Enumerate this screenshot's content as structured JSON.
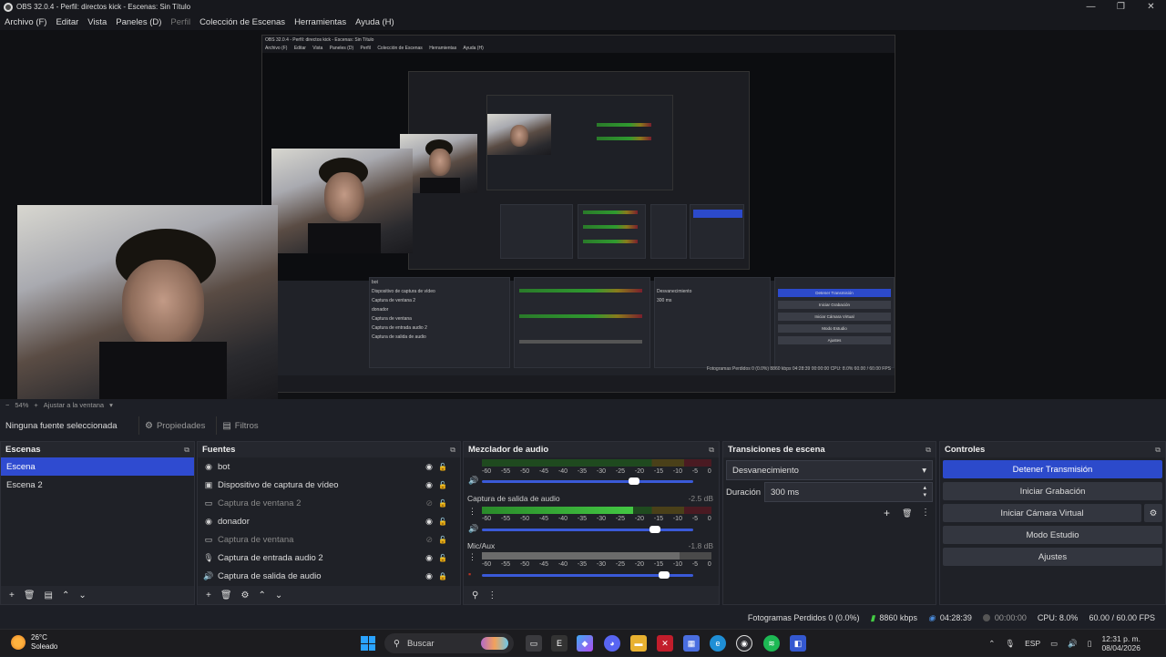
{
  "window": {
    "title": "OBS 32.0.4 - Perfil: directos kick - Escenas: Sin Título",
    "controls": [
      "—",
      "❐",
      "✕"
    ]
  },
  "menu": {
    "items": [
      "Archivo (F)",
      "Editar",
      "Vista",
      "Paneles (D)",
      "Perfil",
      "Colección de Escenas",
      "Herramientas",
      "Ayuda (H)"
    ]
  },
  "nested": {
    "title": "OBS 32.0.4 - Perfil: directos kick - Escenas: Sin Título",
    "menu": [
      "Archivo (F)",
      "Editar",
      "Vista",
      "Paneles (D)",
      "Perfil",
      "Colección de Escenas",
      "Herramientas",
      "Ayuda (H)"
    ],
    "status": "Fotogramas Perdidos 0 (0.0%)   8860 kbps   04:28:39   00:00:00   CPU: 8.0%   60.00 / 60.00 FPS",
    "controls": [
      "Detener Transmisión",
      "Iniciar Grabación",
      "Iniciar Cámara Virtual",
      "Modo Estudio",
      "Ajustes"
    ],
    "sources": [
      "bot",
      "Dispositivo de captura de vídeo",
      "Captura de ventana 2",
      "donador",
      "Captura de ventana",
      "Captura de entrada audio 2",
      "Captura de salida de audio"
    ],
    "transition": "Desvanecimiento",
    "duration": "300 ms"
  },
  "zoom": {
    "level": "54%",
    "fit": "Ajustar a la ventana"
  },
  "toolbar": {
    "no_source": "Ninguna fuente seleccionada",
    "properties": "Propiedades",
    "filters": "Filtros"
  },
  "scenes": {
    "title": "Escenas",
    "items": [
      "Escena",
      "Escena 2"
    ],
    "selected": "Escena"
  },
  "sources": {
    "title": "Fuentes",
    "items": [
      {
        "label": "bot",
        "icon": "globe-icon",
        "visible": true,
        "locked": false
      },
      {
        "label": "Dispositivo de captura de vídeo",
        "icon": "camera-icon",
        "visible": true,
        "locked": false
      },
      {
        "label": "Captura de ventana 2",
        "icon": "window-icon",
        "visible": false,
        "locked": false
      },
      {
        "label": "donador",
        "icon": "globe-icon",
        "visible": true,
        "locked": false
      },
      {
        "label": "Captura de ventana",
        "icon": "window-icon",
        "visible": false,
        "locked": false
      },
      {
        "label": "Captura de entrada audio 2",
        "icon": "mic-icon",
        "visible": true,
        "locked": false
      },
      {
        "label": "Captura de salida de audio",
        "icon": "speaker-icon",
        "visible": true,
        "locked": true
      }
    ]
  },
  "mixer": {
    "title": "Mezclador de audio",
    "scale": [
      "-60",
      "-55",
      "-50",
      "-45",
      "-40",
      "-35",
      "-30",
      "-25",
      "-20",
      "-15",
      "-10",
      "-5",
      "0"
    ],
    "channels": [
      {
        "name": "",
        "db": "",
        "level": 0.0,
        "volume": 0.72
      },
      {
        "name": "Captura de salida de audio",
        "db": "-2.5 dB",
        "level": 0.66,
        "volume": 0.82
      },
      {
        "name": "Mic/Aux",
        "db": "-1.8 dB",
        "level": 0.86,
        "volume": 0.86,
        "muted": true
      }
    ]
  },
  "transitions": {
    "title": "Transiciones de escena",
    "selected": "Desvanecimiento",
    "duration_label": "Duración",
    "duration": "300 ms"
  },
  "controls": {
    "title": "Controles",
    "stop_stream": "Detener Transmisión",
    "start_recording": "Iniciar Grabación",
    "start_virtualcam": "Iniciar Cámara Virtual",
    "studio_mode": "Modo Estudio",
    "settings": "Ajustes"
  },
  "status": {
    "dropped": "Fotogramas Perdidos 0 (0.0%)",
    "bitrate": "8860 kbps",
    "stream_time": "04:28:39",
    "rec_time": "00:00:00",
    "cpu": "CPU: 8.0%",
    "fps": "60.00 / 60.00 FPS"
  },
  "taskbar": {
    "temp": "26°C",
    "weather": "Soleado",
    "search": "Buscar",
    "lang": "ESP",
    "time": "12:31 p. m.",
    "date": "08/04/2026"
  },
  "colors": {
    "accent": "#2c4acb",
    "meter_green": "#43c743",
    "panel": "#25272e"
  }
}
